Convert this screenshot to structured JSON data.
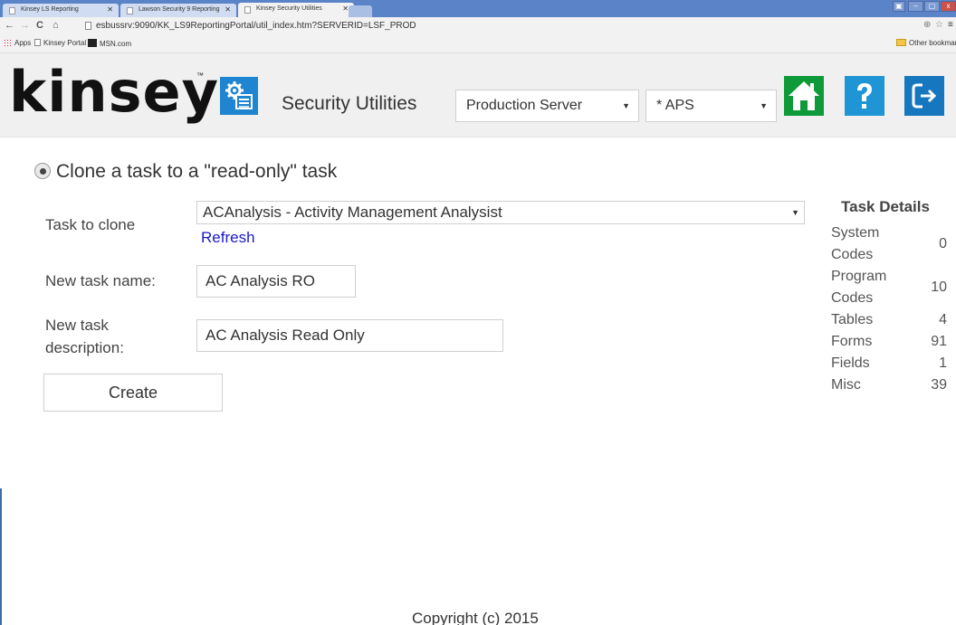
{
  "browser": {
    "tabs": [
      {
        "title": "Kinsey LS Reporting"
      },
      {
        "title": "Lawson Security 9 Reporting"
      },
      {
        "title": "Kinsey Security Utilities"
      }
    ],
    "url": "esbussrv:9090/KK_LS9ReportingPortal/util_index.htm?SERVERID=LSF_PROD",
    "bookmarks": [
      {
        "label": "Apps"
      },
      {
        "label": "Kinsey Portal"
      },
      {
        "label": "MSN.com"
      }
    ],
    "other_bookmarks": "Other bookmarks"
  },
  "header": {
    "logo": "kinsey",
    "logo_tm": "™",
    "title": "Security Utilities",
    "server_select": "Production Server",
    "app_select": "* APS",
    "colors": {
      "home": "#0e9a38",
      "help": "#1f95d6",
      "logout": "#1677bf",
      "utility": "#1f85d0"
    }
  },
  "main": {
    "option_label": "Clone a task to a \"read-only\" task",
    "task_to_clone_label": "Task to clone",
    "task_to_clone_value": "ACAnalysis - Activity Management Analysist",
    "refresh_label": "Refresh",
    "new_task_name_label": "New task name:",
    "new_task_name_value": "AC Analysis RO",
    "new_task_desc_label_line1": "New task",
    "new_task_desc_label_line2": "description:",
    "new_task_desc_value": "AC Analysis Read Only",
    "create_label": "Create"
  },
  "task_details": {
    "title": "Task Details",
    "rows": [
      {
        "name1": "System",
        "name2": "Codes",
        "value": "0"
      },
      {
        "name1": "Program",
        "name2": "Codes",
        "value": "10"
      },
      {
        "name1": "Tables",
        "value": "4"
      },
      {
        "name1": "Forms",
        "value": "91"
      },
      {
        "name1": "Fields",
        "value": "1"
      },
      {
        "name1": "Misc",
        "value": "39"
      }
    ]
  },
  "footer": {
    "copyright": "Copyright (c) 2015"
  }
}
